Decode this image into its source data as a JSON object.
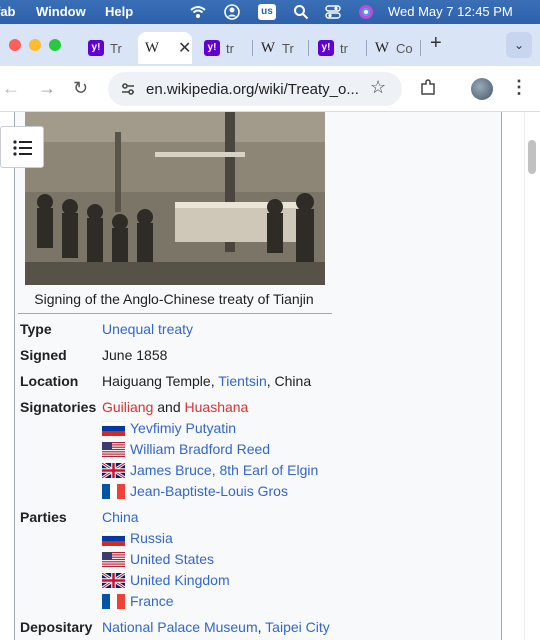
{
  "menubar": {
    "app_partial": "fab",
    "window": "Window",
    "help": "Help",
    "us_badge": "us",
    "datetime": "Wed May 7  12:45 PM"
  },
  "tabs": [
    {
      "favicon": "yahoo",
      "title": "Tr"
    },
    {
      "favicon": "wikipedia",
      "title": ""
    },
    {
      "favicon": "yahoo",
      "title": "tr"
    },
    {
      "favicon": "wikipedia",
      "title": "Tr"
    },
    {
      "favicon": "yahoo",
      "title": "tr"
    },
    {
      "favicon": "wikipedia",
      "title": "Co"
    }
  ],
  "address": {
    "url": "en.wikipedia.org/wiki/Treaty_o..."
  },
  "infobox": {
    "caption": "Signing of the Anglo-Chinese treaty of Tianjin",
    "type_label": "Type",
    "type_value": "Unequal treaty",
    "signed_label": "Signed",
    "signed_value": "June 1858",
    "location_label": "Location",
    "location_prefix": "Haiguang Temple, ",
    "location_link": "Tientsin",
    "location_suffix": ", China",
    "signatories_label": "Signatories",
    "signatory_a": "Guiliang",
    "signatory_and": " and ",
    "signatory_b": "Huashana",
    "signatories": [
      {
        "flag": "russia",
        "name": "Yevfimiy Putyatin"
      },
      {
        "flag": "usa",
        "name": "William Bradford Reed"
      },
      {
        "flag": "uk",
        "name": "James Bruce, 8th Earl of Elgin"
      },
      {
        "flag": "france",
        "name": "Jean-Baptiste-Louis Gros"
      }
    ],
    "parties_label": "Parties",
    "parties_first": "China",
    "parties": [
      {
        "flag": "russia",
        "name": "Russia"
      },
      {
        "flag": "usa",
        "name": "United States"
      },
      {
        "flag": "uk",
        "name": "United Kingdom"
      },
      {
        "flag": "france",
        "name": "France"
      }
    ],
    "depositary_label": "Depositary",
    "depositary_a": "National Palace Museum",
    "depositary_sep": ", ",
    "depositary_b": "Taipei City"
  },
  "colors": {
    "link": "#3366cc",
    "redlink": "#d73333",
    "tabstrip": "#d9e4f7"
  }
}
